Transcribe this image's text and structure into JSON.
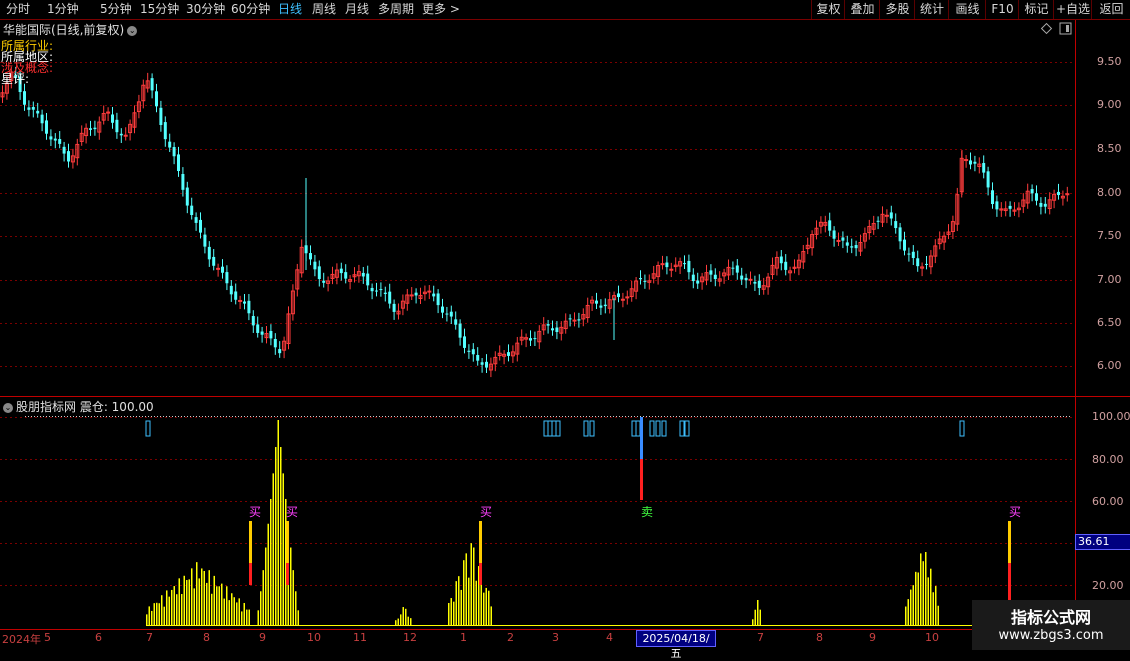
{
  "toolbar": {
    "periods": [
      "分时",
      "1分钟",
      "5分钟",
      "15分钟",
      "30分钟",
      "60分钟",
      "日线",
      "周线",
      "月线",
      "多周期",
      "更多 >"
    ],
    "active_index": 6,
    "right_buttons": [
      "复权",
      "叠加",
      "多股",
      "统计",
      "画线",
      "F10",
      "标记",
      "+自选",
      "返回"
    ]
  },
  "chart": {
    "stock_title": "华能国际(日线,前复权)",
    "info_lines": [
      "所属行业:",
      "所属地区:",
      "涉及概念:",
      "星评:"
    ],
    "y_labels": [
      "9.50",
      "9.00",
      "8.50",
      "8.00",
      "7.50",
      "7.00",
      "6.50",
      "6.00"
    ]
  },
  "indicator": {
    "title": "股朋指标网 震仓: 100.00",
    "y_labels": [
      "100.00",
      "80.00",
      "60.00",
      "20.00"
    ],
    "current_value": "36.61",
    "buy_label": "买",
    "sell_label": "卖"
  },
  "x_axis": {
    "labels": [
      "2024年",
      "5",
      "6",
      "7",
      "8",
      "9",
      "10",
      "11",
      "12",
      "1",
      "2",
      "3",
      "4",
      "7",
      "8",
      "9",
      "10"
    ],
    "cursor_date": "2025/04/18/五"
  },
  "watermark": {
    "line1": "指标公式网",
    "line2": "www.zbgs3.com"
  },
  "colors": {
    "up": "#ff3c3c",
    "down": "#54ffff",
    "volume": "#ffff00",
    "axis_red": "#c00000"
  }
}
